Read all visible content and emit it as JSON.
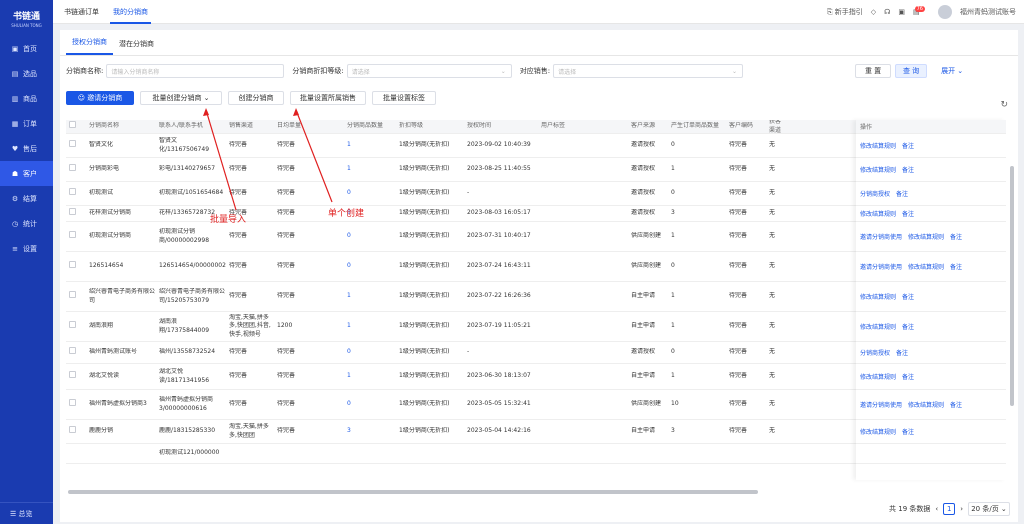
{
  "logo": {
    "name": "书链通",
    "sub": "SHULIAN TONG"
  },
  "sidebar": [
    {
      "icon": "▣",
      "label": "首页"
    },
    {
      "icon": "▤",
      "label": "选品"
    },
    {
      "icon": "▥",
      "label": "商品"
    },
    {
      "icon": "▦",
      "label": "订单"
    },
    {
      "icon": "♥",
      "label": "售后"
    },
    {
      "icon": "☗",
      "label": "客户",
      "active": true
    },
    {
      "icon": "⚙",
      "label": "结算"
    },
    {
      "icon": "◷",
      "label": "统计"
    },
    {
      "icon": "≡",
      "label": "设置"
    }
  ],
  "sidebar_bottom": "总览",
  "topbar": {
    "tabs": [
      "书链通订单",
      "我的分销商"
    ],
    "guide": "新手指引",
    "badge": "76",
    "user": "福州青蚂测试账号"
  },
  "subtabs": [
    "授权分销商",
    "潜在分销商"
  ],
  "filters": {
    "name_label": "分销商名称:",
    "name_placeholder": "请输入分销商名称",
    "level_label": "分销商折扣等级:",
    "level_placeholder": "请选择",
    "sales_label": "对应销售:",
    "sales_placeholder": "请选择",
    "reset": "重 置",
    "search": "查 询",
    "expand": "展开"
  },
  "actions": {
    "invite": "邀请分销商",
    "batch_create": "批量创建分销商",
    "create": "创建分销商",
    "set_sales": "批量设置所属销售",
    "set_tag": "批量设置标签"
  },
  "annotations": {
    "batch": "批量导入",
    "single": "单个创建"
  },
  "columns": [
    "分销商名称",
    "联系人/联系手机",
    "销售渠道",
    "日均单量",
    "分销商品数量",
    "折扣等级",
    "授权时间",
    "用户标签",
    "客户来源",
    "产生订单商品数量",
    "客户编码",
    "获客渠道",
    "操作"
  ],
  "rows": [
    [
      "智贤文化",
      "智贤文化/13167506749",
      "待完善",
      "待完善",
      "1",
      "1级分销商(无折扣)",
      "2023-09-02 10:40:39",
      "",
      "邀请授权",
      "0",
      "待完善",
      "无",
      "修改结算规则|备注"
    ],
    [
      "分销商彩电",
      "彩电/13140279657",
      "待完善",
      "待完善",
      "1",
      "1级分销商(无折扣)",
      "2023-08-25 11:40:55",
      "",
      "邀请授权",
      "1",
      "待完善",
      "无",
      "修改结算规则|备注"
    ],
    [
      "初现测试",
      "初现测试/1051654684",
      "待完善",
      "待完善",
      "0",
      "1级分销商(无折扣)",
      "-",
      "",
      "邀请授权",
      "0",
      "待完善",
      "无",
      "分销商授权|备注"
    ],
    [
      "花梓测试分销商",
      "花梓/13365728732",
      "待完善",
      "待完善",
      "8",
      "1级分销商(无折扣)",
      "2023-08-03 16:05:17",
      "",
      "邀请授权",
      "3",
      "待完善",
      "无",
      "修改结算规则|备注"
    ],
    [
      "初现测试分销商",
      "初现测试分销商/00000002998",
      "待完善",
      "待完善",
      "0",
      "1级分销商(无折扣)",
      "2023-07-31 10:40:17",
      "",
      "供应商创建",
      "1",
      "待完善",
      "无",
      "邀请分销商使用|修改结算规则|备注"
    ],
    [
      "126514654",
      "126514654/00000002721",
      "待完善",
      "待完善",
      "0",
      "1级分销商(无折扣)",
      "2023-07-24 16:43:11",
      "",
      "供应商创建",
      "0",
      "待完善",
      "无",
      "邀请分销商使用|修改结算规则|备注"
    ],
    [
      "绍兴睿青电子商务有限公司",
      "绍兴睿青电子商务有限公司/15205753079",
      "待完善",
      "待完善",
      "1",
      "1级分销商(无折扣)",
      "2023-07-22 16:26:36",
      "",
      "自主申请",
      "1",
      "待完善",
      "无",
      "修改结算规则|备注"
    ],
    [
      "湖南浪翔",
      "湖南浪翔/17375844009",
      "淘宝,天猫,拼多多,快团团,抖音,快手,视频号",
      "1200",
      "1",
      "1级分销商(无折扣)",
      "2023-07-19 11:05:21",
      "",
      "自主申请",
      "1",
      "待完善",
      "无",
      "修改结算规则|备注"
    ],
    [
      "福州青蚂测试账号",
      "福州/13558732524",
      "待完善",
      "待完善",
      "0",
      "1级分销商(无折扣)",
      "-",
      "",
      "邀请授权",
      "0",
      "待完善",
      "无",
      "分销商授权|备注"
    ],
    [
      "湖北艾悦读",
      "湖北艾悦读/18171341956",
      "待完善",
      "待完善",
      "1",
      "1级分销商(无折扣)",
      "2023-06-30 18:13:07",
      "",
      "自主申请",
      "1",
      "待完善",
      "无",
      "修改结算规则|备注"
    ],
    [
      "福州青蚂虚拟分销商3",
      "福州青蚂虚拟分销商3/00000000616",
      "待完善",
      "待完善",
      "0",
      "1级分销商(无折扣)",
      "2023-05-05 15:32:41",
      "",
      "供应商创建",
      "10",
      "待完善",
      "无",
      "邀请分销商使用|修改结算规则|备注"
    ],
    [
      "鹿鹿分销",
      "鹿鹿/18315285330",
      "淘宝,天猫,拼多多,快团团",
      "待完善",
      "3",
      "1级分销商(无折扣)",
      "2023-05-04 14:42:16",
      "",
      "自主申请",
      "3",
      "待完善",
      "无",
      "修改结算规则|备注"
    ],
    [
      "",
      "初现测试121/000000",
      "",
      "",
      "",
      "",
      "",
      "",
      "",
      "",
      "",
      "",
      ""
    ]
  ],
  "pager": {
    "total": "共 19 条数据",
    "page": "1",
    "size": "20 条/页"
  }
}
